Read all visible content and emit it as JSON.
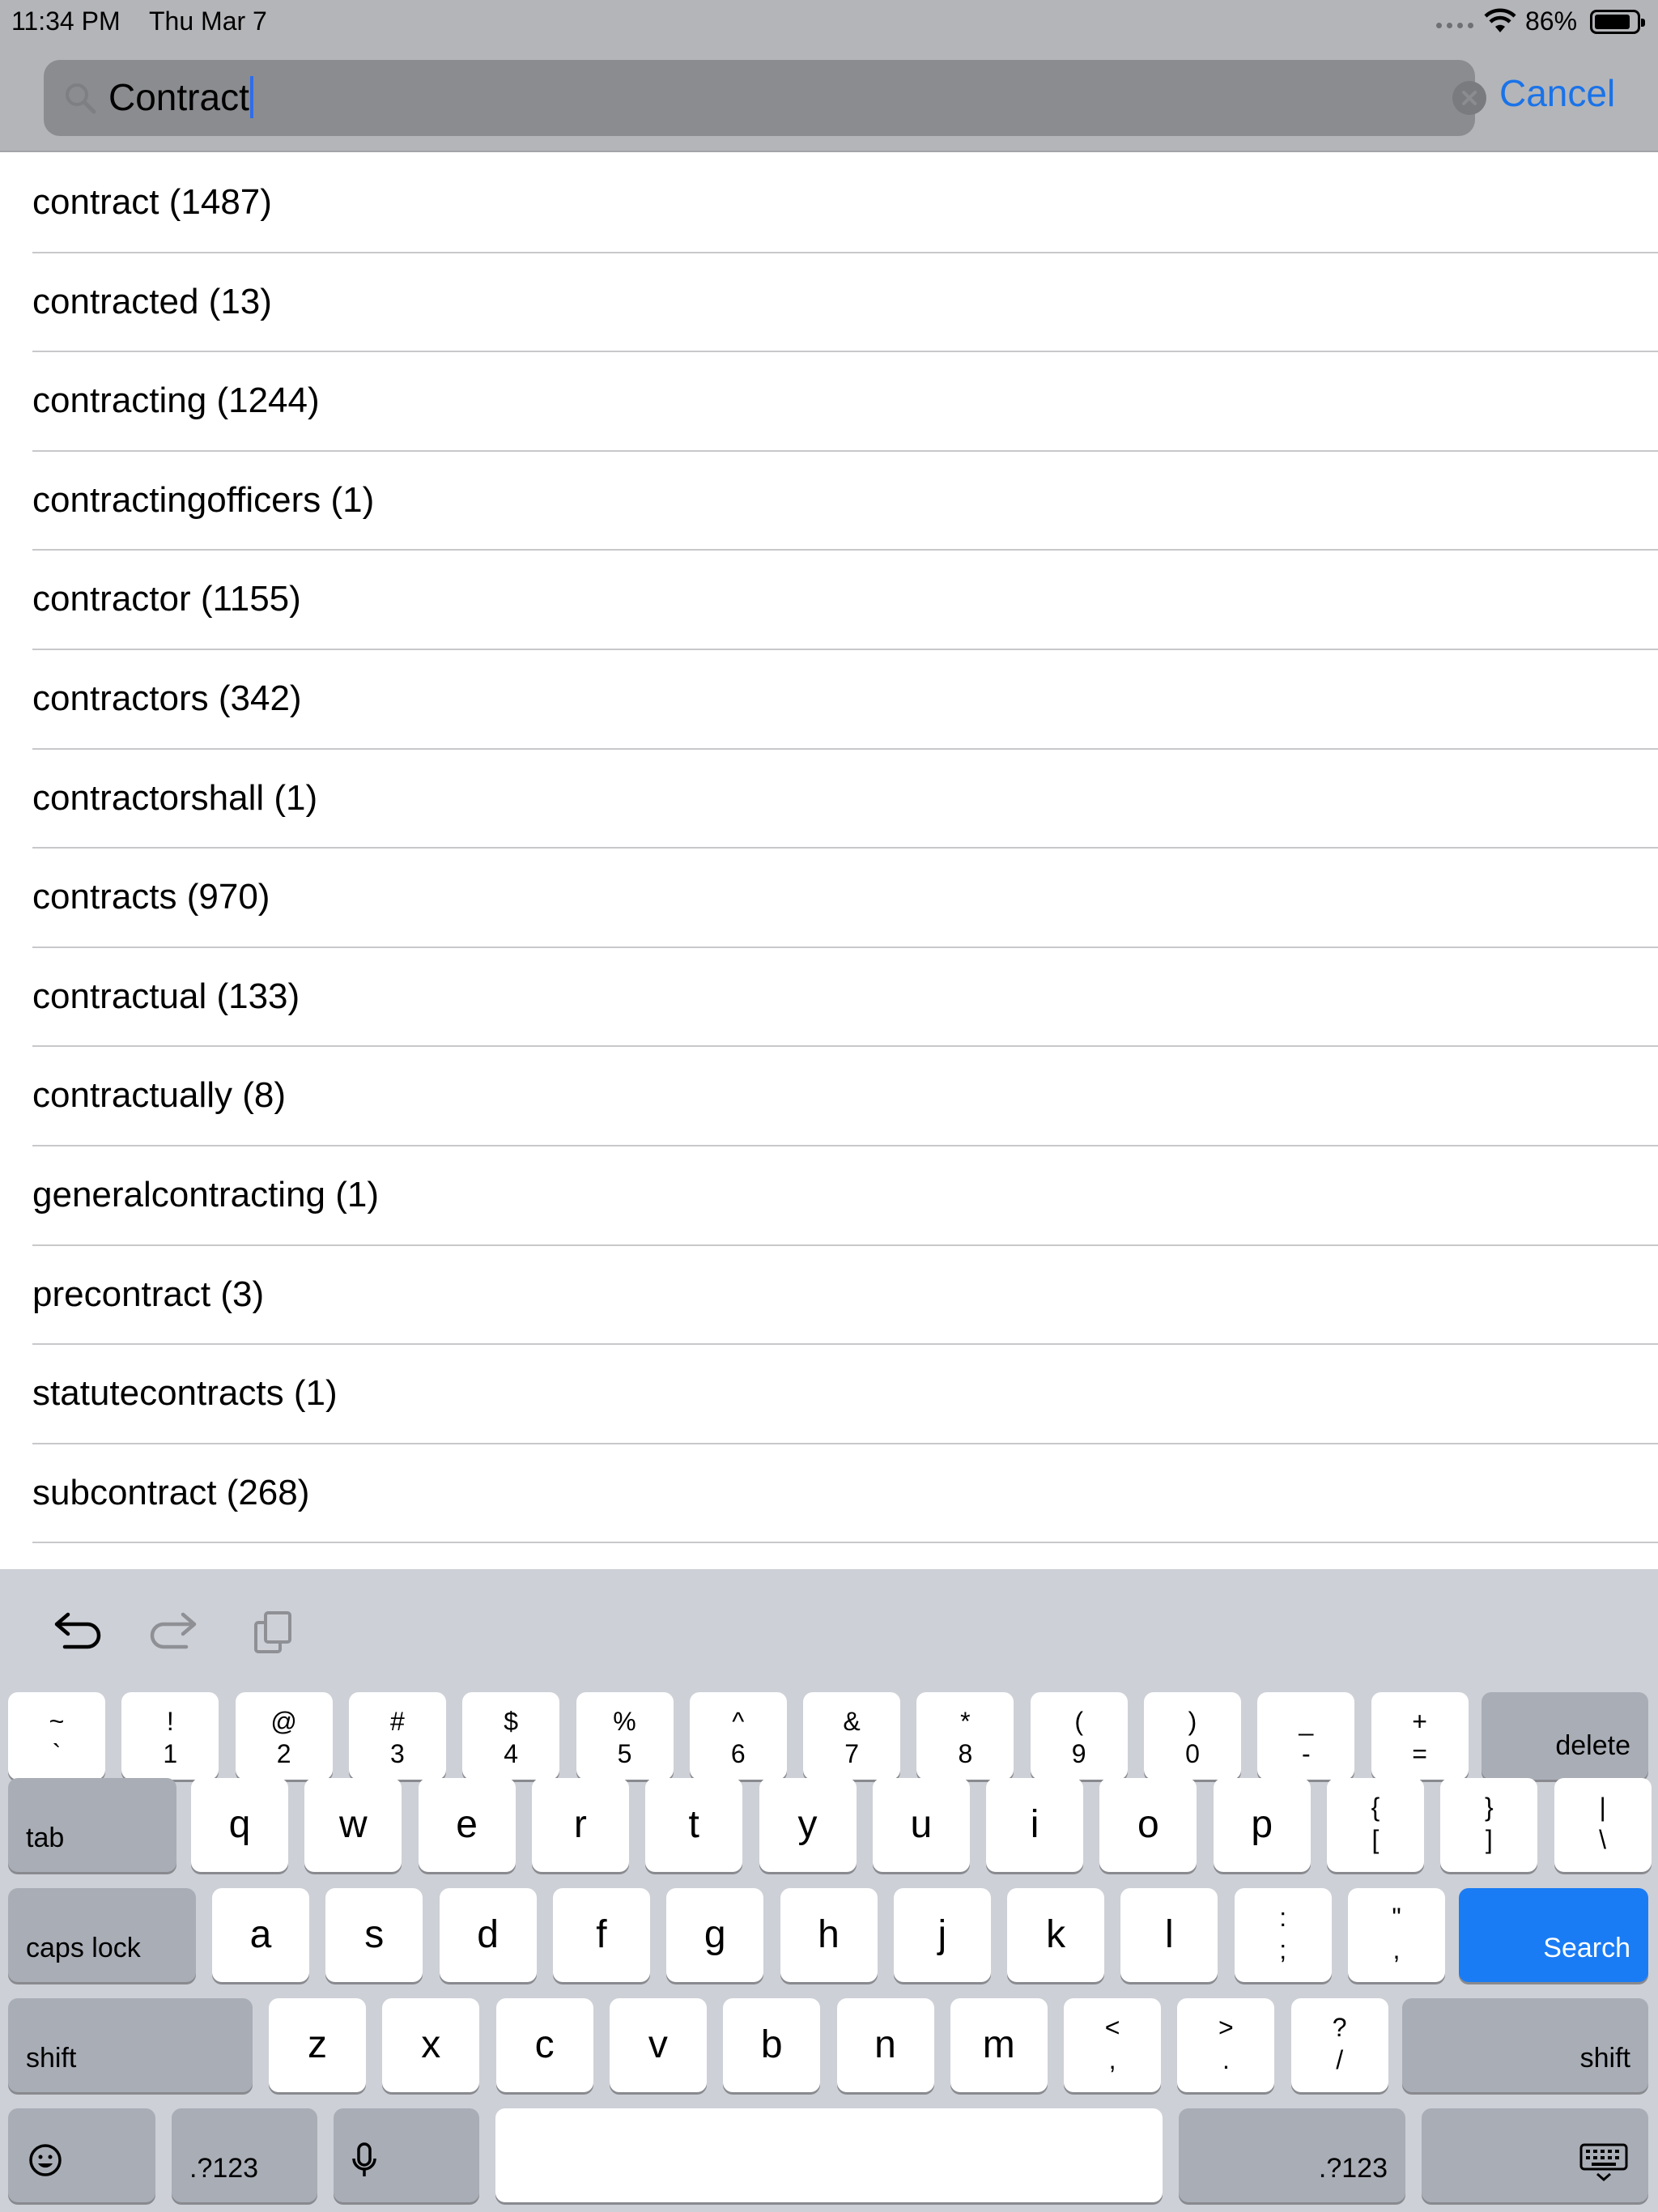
{
  "status_bar": {
    "time": "11:34 PM",
    "date": "Thu Mar 7",
    "battery_percent": "86%",
    "battery_level": 0.86,
    "icons": [
      "cellular-dots-icon",
      "wifi-icon",
      "battery-icon"
    ]
  },
  "search": {
    "query": "Contract",
    "cancel_label": "Cancel",
    "accent_color": "#1a73e8"
  },
  "results": [
    "contract (1487)",
    "contracted (13)",
    "contracting (1244)",
    "contractingofficers (1)",
    "contractor (1155)",
    "contractors (342)",
    "contractorshall (1)",
    "contracts (970)",
    "contractual (133)",
    "contractually (8)",
    "generalcontracting (1)",
    "precontract (3)",
    "statutecontracts (1)",
    "subcontract (268)"
  ],
  "keyboard": {
    "toolbar_icons": [
      "undo-icon",
      "redo-icon",
      "clipboard-icon"
    ],
    "number_row": [
      [
        "~",
        "`"
      ],
      [
        "!",
        "1"
      ],
      [
        "@",
        "2"
      ],
      [
        "#",
        "3"
      ],
      [
        "$",
        "4"
      ],
      [
        "%",
        "5"
      ],
      [
        "^",
        "6"
      ],
      [
        "&",
        "7"
      ],
      [
        "*",
        "8"
      ],
      [
        "(",
        "9"
      ],
      [
        ")",
        "0"
      ],
      [
        "_",
        "-"
      ],
      [
        "+",
        "="
      ]
    ],
    "delete_label": "delete",
    "tab_label": "tab",
    "row_q": [
      "q",
      "w",
      "e",
      "r",
      "t",
      "y",
      "u",
      "i",
      "o",
      "p"
    ],
    "row_q_symbols": [
      [
        "{",
        "["
      ],
      [
        "}",
        "]"
      ],
      [
        "|",
        "\\"
      ]
    ],
    "caps_label": "caps lock",
    "row_a": [
      "a",
      "s",
      "d",
      "f",
      "g",
      "h",
      "j",
      "k",
      "l"
    ],
    "row_a_symbols": [
      [
        ":",
        ";"
      ],
      [
        "\"",
        ","
      ]
    ],
    "search_label": "Search",
    "shift_label": "shift",
    "row_z": [
      "z",
      "x",
      "c",
      "v",
      "b",
      "n",
      "m"
    ],
    "row_z_symbols": [
      [
        "<",
        ","
      ],
      [
        ">",
        "."
      ],
      [
        "?",
        "/"
      ]
    ],
    "numbers_label": ".?123",
    "bottom_icons": [
      "emoji-icon",
      "microphone-icon",
      "keyboard-dismiss-icon"
    ]
  }
}
